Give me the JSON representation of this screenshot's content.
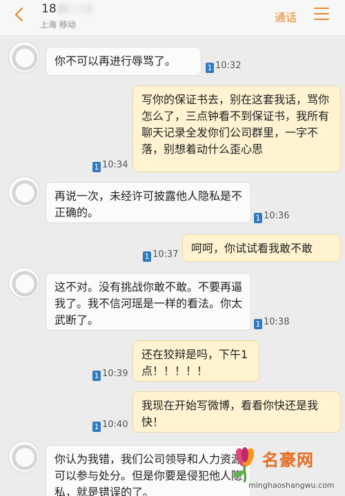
{
  "header": {
    "contact_name": "18",
    "contact_location": "上海 移动",
    "call_label": "通话"
  },
  "messages": [
    {
      "dir": "in",
      "text": "你不可以再进行辱骂了。",
      "time": "10:32",
      "sim": "1"
    },
    {
      "dir": "out",
      "text": "写你的保证书去，别在这套我话，骂你怎么了，三点钟看不到保证书，我所有聊天记录全发你们公司群里，一字不落，别想着动什么歪心思",
      "time": "10:34",
      "sim": "1"
    },
    {
      "dir": "in",
      "text": "再说一次，未经许可披露他人隐私是不正确的。",
      "time": "10:36",
      "sim": "1"
    },
    {
      "dir": "out",
      "text": "呵呵，你试试看我敢不敢",
      "time": "10:37",
      "sim": "1"
    },
    {
      "dir": "in",
      "text": "这不对。没有挑战你敢不敢。不要再逼我了。我不信河瑶是一样的看法。你太武断了。",
      "time": "10:38",
      "sim": "1"
    },
    {
      "dir": "out",
      "text": "还在狡辩是吗，下午1点！！！！！",
      "time": "10:39",
      "sim": "1"
    },
    {
      "dir": "out",
      "text": "我现在开始写微博，看看你快还是我快！",
      "time": "10:40",
      "sim": "1"
    },
    {
      "dir": "in",
      "text": "你认为我错，我们公司领导和人力资源可以参与处分。但是你要是侵犯他人隐私，就是错误的了。",
      "time": "",
      "sim": ""
    }
  ],
  "watermark": {
    "title": "名豪网",
    "url": "minghaoshangwu.com"
  },
  "colors": {
    "accent": "#e48a2a",
    "incoming_bubble": "#fbfbfb",
    "outgoing_bubble": "#fff3d2",
    "background": "#ececec"
  }
}
